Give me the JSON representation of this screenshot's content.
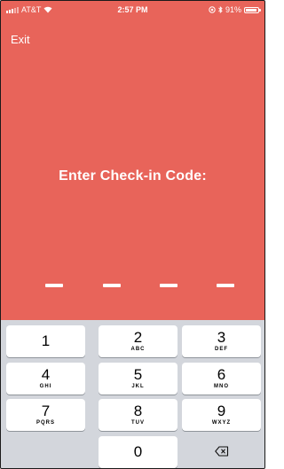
{
  "status_bar": {
    "carrier": "AT&T",
    "time": "2:57 PM",
    "battery": "91%",
    "battery_level": 0.91,
    "icons": [
      "signal-icon",
      "wifi-icon",
      "location-icon",
      "bluetooth-icon",
      "battery-icon"
    ]
  },
  "nav": {
    "exit_label": "Exit"
  },
  "main": {
    "prompt": "Enter Check-in Code:",
    "code_slot_count": 4,
    "code_value": ""
  },
  "keypad": {
    "keys": [
      {
        "digit": "1",
        "letters": ""
      },
      {
        "digit": "2",
        "letters": "ABC"
      },
      {
        "digit": "3",
        "letters": "DEF"
      },
      {
        "digit": "4",
        "letters": "GHI"
      },
      {
        "digit": "5",
        "letters": "JKL"
      },
      {
        "digit": "6",
        "letters": "MNO"
      },
      {
        "digit": "7",
        "letters": "PQRS"
      },
      {
        "digit": "8",
        "letters": "TUV"
      },
      {
        "digit": "9",
        "letters": "WXYZ"
      },
      {
        "digit": "0",
        "letters": ""
      }
    ],
    "delete_icon": "backspace-icon"
  },
  "colors": {
    "background": "#E8645A",
    "keypad_background": "#D3D6DC",
    "key": "#FFFFFF",
    "text_light": "#FFFFFF"
  }
}
